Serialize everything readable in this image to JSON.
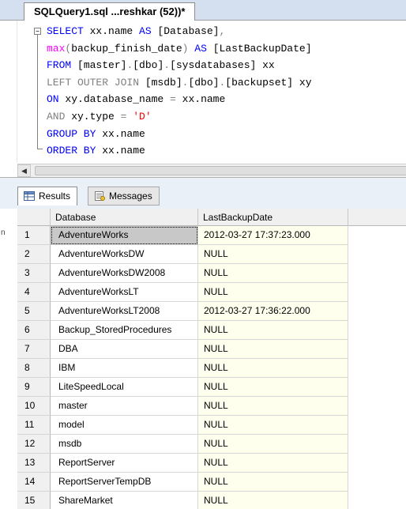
{
  "editor_tab": {
    "title": "SQLQuery1.sql ...reshkar (52))*"
  },
  "code_lines": [
    [
      {
        "t": "SELECT",
        "c": "kw"
      },
      {
        "t": " xx.name ",
        "c": "plain"
      },
      {
        "t": "AS",
        "c": "kw"
      },
      {
        "t": " [Database]",
        "c": "plain"
      },
      {
        "t": ",",
        "c": "gr"
      }
    ],
    [
      {
        "t": "max",
        "c": "fn"
      },
      {
        "t": "(",
        "c": "gr"
      },
      {
        "t": "backup_finish_date",
        "c": "plain"
      },
      {
        "t": ")",
        "c": "gr"
      },
      {
        "t": " AS ",
        "c": "kw"
      },
      {
        "t": "[LastBackupDate]",
        "c": "plain"
      }
    ],
    [
      {
        "t": "FROM",
        "c": "kw"
      },
      {
        "t": " [master]",
        "c": "plain"
      },
      {
        "t": ".",
        "c": "gr"
      },
      {
        "t": "[dbo]",
        "c": "plain"
      },
      {
        "t": ".",
        "c": "gr"
      },
      {
        "t": "[sysdatabases] xx",
        "c": "plain"
      }
    ],
    [
      {
        "t": "LEFT OUTER JOIN",
        "c": "gr"
      },
      {
        "t": " [msdb]",
        "c": "plain"
      },
      {
        "t": ".",
        "c": "gr"
      },
      {
        "t": "[dbo]",
        "c": "plain"
      },
      {
        "t": ".",
        "c": "gr"
      },
      {
        "t": "[backupset] xy",
        "c": "plain"
      }
    ],
    [
      {
        "t": "ON",
        "c": "kw"
      },
      {
        "t": " xy.database_name ",
        "c": "plain"
      },
      {
        "t": "=",
        "c": "gr"
      },
      {
        "t": " xx.name",
        "c": "plain"
      }
    ],
    [
      {
        "t": "AND",
        "c": "gr"
      },
      {
        "t": " xy.type ",
        "c": "plain"
      },
      {
        "t": "=",
        "c": "gr"
      },
      {
        "t": " ",
        "c": "plain"
      },
      {
        "t": "'D'",
        "c": "str"
      }
    ],
    [
      {
        "t": "GROUP BY",
        "c": "kw"
      },
      {
        "t": " xx.name",
        "c": "plain"
      }
    ],
    [
      {
        "t": "ORDER BY",
        "c": "kw"
      },
      {
        "t": " xx.name",
        "c": "plain"
      }
    ]
  ],
  "collapse_glyph": "−",
  "scroll_left_glyph": "◀",
  "results_tabs": {
    "results_label": "Results",
    "messages_label": "Messages"
  },
  "grid": {
    "columns": [
      "Database",
      "LastBackupDate"
    ],
    "rows": [
      {
        "n": "1",
        "db": "AdventureWorks",
        "dt": "2012-03-27 17:37:23.000"
      },
      {
        "n": "2",
        "db": "AdventureWorksDW",
        "dt": "NULL"
      },
      {
        "n": "3",
        "db": "AdventureWorksDW2008",
        "dt": "NULL"
      },
      {
        "n": "4",
        "db": "AdventureWorksLT",
        "dt": "NULL"
      },
      {
        "n": "5",
        "db": "AdventureWorksLT2008",
        "dt": "2012-03-27 17:36:22.000"
      },
      {
        "n": "6",
        "db": "Backup_StoredProcedures",
        "dt": "NULL"
      },
      {
        "n": "7",
        "db": "DBA",
        "dt": "NULL"
      },
      {
        "n": "8",
        "db": "IBM",
        "dt": "NULL"
      },
      {
        "n": "9",
        "db": "LiteSpeedLocal",
        "dt": "NULL"
      },
      {
        "n": "10",
        "db": "master",
        "dt": "NULL"
      },
      {
        "n": "11",
        "db": "model",
        "dt": "NULL"
      },
      {
        "n": "12",
        "db": "msdb",
        "dt": "NULL"
      },
      {
        "n": "13",
        "db": "ReportServer",
        "dt": "NULL"
      },
      {
        "n": "14",
        "db": "ReportServerTempDB",
        "dt": "NULL"
      },
      {
        "n": "15",
        "db": "ShareMarket",
        "dt": "NULL"
      }
    ],
    "selected_row": 0
  },
  "side_label": "n",
  "colors": {
    "keyword": "#0000ff",
    "function": "#ff00ff",
    "operator": "#808080",
    "string": "#ff0000",
    "datetime_col_bg": "#ffffee"
  }
}
